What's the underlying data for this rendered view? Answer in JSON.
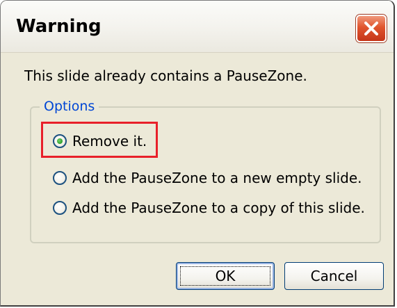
{
  "dialog": {
    "title": "Warning",
    "close_icon": "close-icon",
    "message": "This slide already contains a PauseZone.",
    "options_group": {
      "label": "Options",
      "items": [
        {
          "label": "Remove it.",
          "checked": true
        },
        {
          "label": "Add the PauseZone to a new empty slide.",
          "checked": false
        },
        {
          "label": "Add the PauseZone to a copy of this slide.",
          "checked": false
        }
      ]
    },
    "buttons": {
      "ok": "OK",
      "cancel": "Cancel"
    }
  },
  "colors": {
    "highlight": "#e8202a",
    "group_label": "#0046d5",
    "close_button": "#e0542d",
    "dialog_bg": "#ece9d8"
  }
}
